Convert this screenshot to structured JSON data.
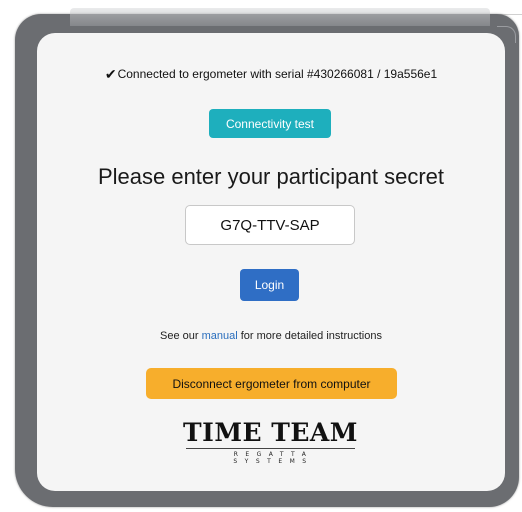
{
  "status": {
    "check_icon": "checkmark-icon",
    "message": "Connected to ergometer with serial #430266081 / 19a556e1"
  },
  "buttons": {
    "connectivity_test": "Connectivity test",
    "login": "Login",
    "disconnect": "Disconnect ergometer from computer"
  },
  "form": {
    "heading": "Please enter your participant secret",
    "secret_value": "G7Q-TTV-SAP"
  },
  "help": {
    "prefix": "See our",
    "link_text": "manual",
    "suffix": "for more detailed instructions"
  },
  "logo": {
    "main": "TIME TEAM",
    "sub": "REGATTA SYSTEMS"
  },
  "colors": {
    "connectivity_button": "#1eafbd",
    "login_button": "#2f6ec5",
    "disconnect_button": "#f7ae2c",
    "link": "#2a6ebd",
    "panel_background": "#f5f5f5",
    "frame": "#6b6d71"
  }
}
